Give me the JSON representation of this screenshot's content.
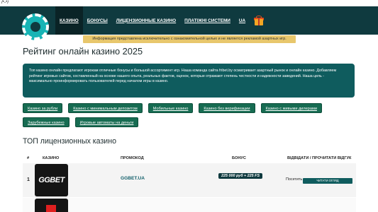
{
  "comment": "/*-*/",
  "nav": {
    "items": [
      "КАЗИНО",
      "БОНУСЫ",
      "ЛИЦЕНЗИОННЫЕ КАЗИНО",
      "ПЛАТІЖНІ СИСТЕМИ",
      "UA"
    ],
    "active_index": 0
  },
  "notice": "Информация представлена исключительно с ознакомительной целью и не является рекламой азартных игр.",
  "title": "Рейтинг онлайн казино 2025",
  "intro": "Топ казино онлайн предлагают игрокам отличные бонусы и большой ассортимент игр. Наша команда сайта fribet.by осматривает азартный рынок и онлайн казино. Добавляем рейтинг игровых сайтов, составленный на основе нашего опыта, реальных фактов, оценок, которые отражают степень честности и надежности заведений. Наша цель - максимально проинформировать пользователей перед началом игры в казино.",
  "tags": [
    "Казино за рубли",
    "Казино с минимальным депозитом",
    "Мобильные казино",
    "Казино без верификации",
    "Казино с живыми дилерами",
    "Зарубежные казино",
    "Игровые автоматы на деньги"
  ],
  "section_title": "ТОП лицензионных казино",
  "table": {
    "headers": [
      "#",
      "КАЗИНО",
      "ПРОМОКОД",
      "БОНУС",
      "ВІДВІДАТИ / ПРОЧИТАТИ ВІДГУК"
    ],
    "rows": [
      {
        "num": "1",
        "brand": "GGBET",
        "promo": "GGBET.UA",
        "bonus": "225 000 руб + 225 FS",
        "visit": "Посетить",
        "review": "ЧИТАТИ ОГЛЯД"
      }
    ]
  },
  "colors": {
    "header_bg": "#0f3a3f",
    "teal_panel": "#0f5c5e",
    "tag_green": "#176c52",
    "notice_yellow": "#e8c76c",
    "logo_teal": "#17b4b5"
  },
  "icons": {
    "logo": "casino-chip-logo",
    "gift": "gift-icon"
  }
}
